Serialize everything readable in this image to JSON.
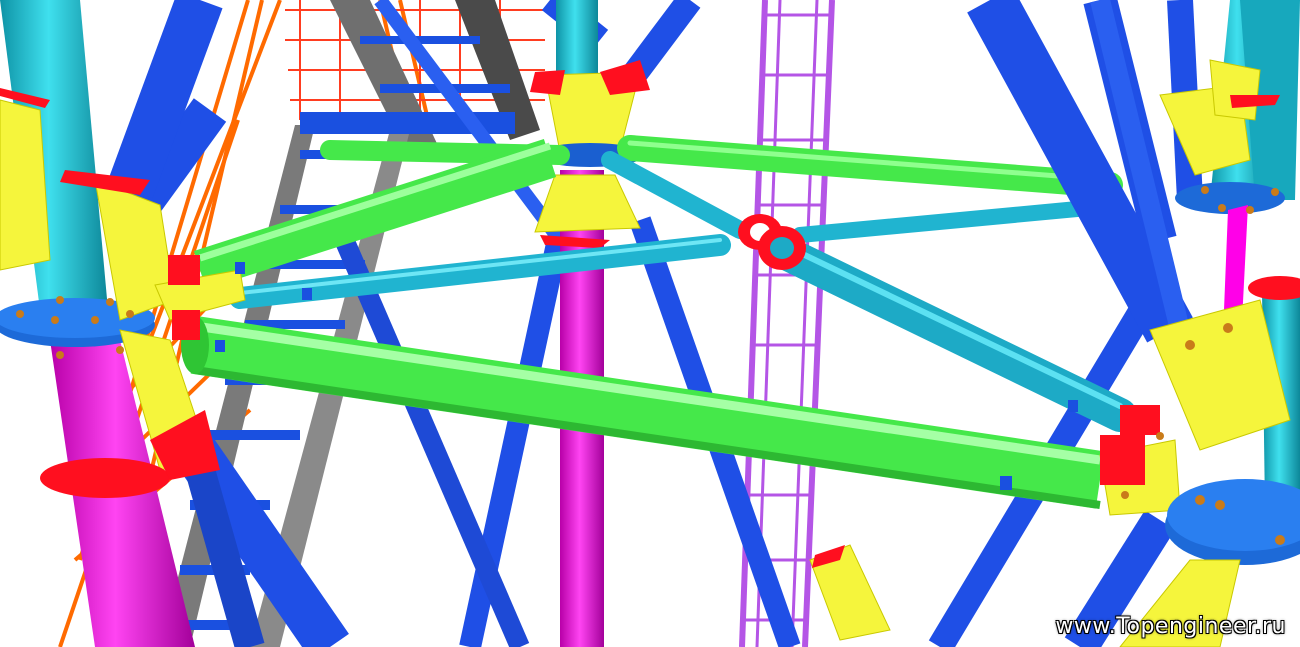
{
  "watermark": {
    "text": "www.Topengineer.ru"
  },
  "colors": {
    "background": "#ffffff",
    "column_upper": "#18c4d4",
    "column_lower": "#ff00e8",
    "brace_blue": "#1f4fe6",
    "tie_green": "#45e84a",
    "tie_cyan": "#20b4d0",
    "gusset_yellow": "#f5f53c",
    "cleat_red": "#ff0f1f",
    "flange_blue": "#1d6ad8",
    "stair_gray": "#7a7a7a",
    "railing_orange": "#ff6a00",
    "ladder_violet": "#c060f0"
  },
  "icons": [
    "steel-tower-node-render"
  ]
}
